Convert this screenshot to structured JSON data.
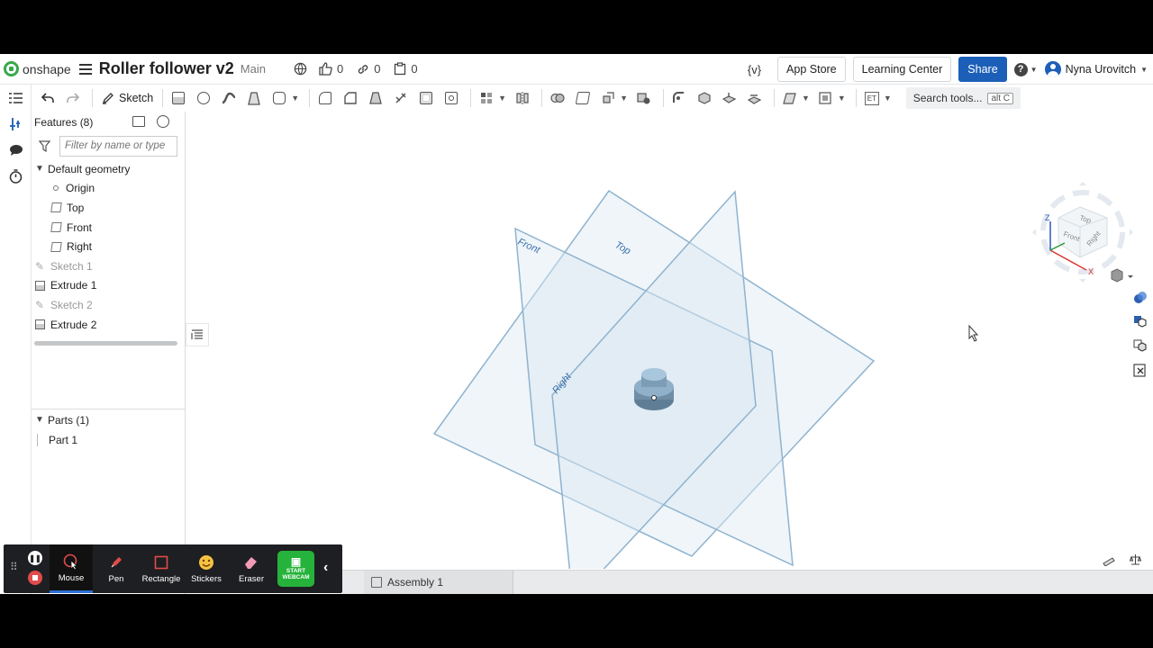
{
  "header": {
    "brand": "onshape",
    "doc_title": "Roller follower v2",
    "branch": "Main",
    "likes": "0",
    "links": "0",
    "copies": "0",
    "variable_label": "{v}",
    "app_store": "App Store",
    "learning_center": "Learning Center",
    "share": "Share",
    "help": "?",
    "user": "Nyna Urovitch"
  },
  "toolbar": {
    "sketch_label": "Sketch",
    "et_label": "ET",
    "search_label": "Search tools...",
    "search_shortcut": "alt C"
  },
  "features": {
    "title": "Features (8)",
    "filter_placeholder": "Filter by name or type",
    "default_geometry": "Default geometry",
    "items": [
      {
        "label": "Origin"
      },
      {
        "label": "Top"
      },
      {
        "label": "Front"
      },
      {
        "label": "Right"
      },
      {
        "label": "Sketch 1"
      },
      {
        "label": "Extrude 1"
      },
      {
        "label": "Sketch 2"
      },
      {
        "label": "Extrude 2"
      }
    ],
    "parts_title": "Parts (1)",
    "parts": [
      {
        "label": "Part 1"
      }
    ]
  },
  "viewport": {
    "plane_labels": [
      "Front",
      "Top",
      "Right"
    ],
    "cube_labels": [
      "Top",
      "Front",
      "Right"
    ],
    "axis_labels": [
      "Z",
      "X"
    ]
  },
  "tabs": [
    {
      "label": "Assembly 1"
    }
  ],
  "recorder": {
    "tools": [
      {
        "label": "Mouse",
        "icon": "mouse-cursor-icon"
      },
      {
        "label": "Pen",
        "icon": "pen-icon"
      },
      {
        "label": "Rectangle",
        "icon": "rectangle-icon"
      },
      {
        "label": "Stickers",
        "icon": "sticker-icon"
      },
      {
        "label": "Eraser",
        "icon": "eraser-icon"
      }
    ],
    "webcam_line1": "START",
    "webcam_line2": "WEBCAM"
  }
}
